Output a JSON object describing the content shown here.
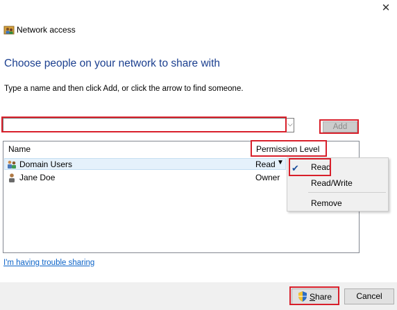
{
  "window": {
    "title": "Network access",
    "close_glyph": "✕",
    "title_icon": "network-people-icon"
  },
  "main": {
    "heading": "Choose people on your network to share with",
    "instruction": "Type a name and then click Add, or click the arrow to find someone.",
    "name_input": {
      "value": "",
      "placeholder": ""
    },
    "combo_arrow": "⌵",
    "add_label": "Add"
  },
  "list": {
    "columns": [
      "Name",
      "Permission Level"
    ],
    "rows": [
      {
        "name": "Domain Users",
        "permission": "Read",
        "icon": "group-users-icon",
        "caret": "▼"
      },
      {
        "name": "Jane Doe",
        "permission": "Owner",
        "icon": "user-icon"
      }
    ]
  },
  "permission_menu": {
    "items": [
      {
        "label": "Read",
        "checked": true,
        "check_glyph": "✔"
      },
      {
        "label": "Read/Write",
        "checked": false
      },
      {
        "label": "Remove",
        "checked": false
      }
    ]
  },
  "links": {
    "trouble": "I'm having trouble sharing"
  },
  "footer": {
    "share_first": "S",
    "share_rest": "hare",
    "share_icon": "uac-shield-icon",
    "cancel_label": "Cancel"
  },
  "colors": {
    "heading": "#1b3f8f",
    "highlight_red": "#d81f2a",
    "link": "#0b63c8",
    "selected_row": "#e5f1fb"
  }
}
